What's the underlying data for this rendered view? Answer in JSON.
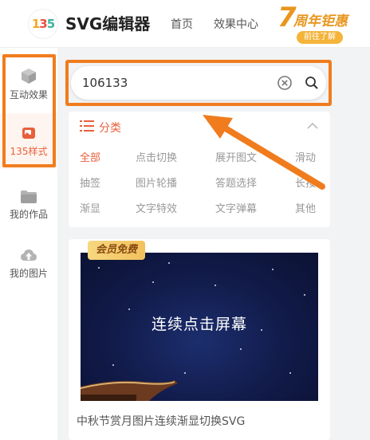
{
  "header": {
    "logo_text": "135",
    "title": "SVG编辑器",
    "nav": [
      "首页",
      "效果中心"
    ],
    "promo": {
      "number": "7",
      "title": "周年钜惠",
      "button": "前往了解"
    }
  },
  "sidebar": {
    "items": [
      {
        "label": "互动效果",
        "icon": "cube-icon"
      },
      {
        "label": "135样式",
        "icon": "image-gallery-icon"
      },
      {
        "label": "我的作品",
        "icon": "folder-icon"
      },
      {
        "label": "我的图片",
        "icon": "cloud-upload-icon"
      }
    ],
    "active_index": 1
  },
  "search": {
    "value": "106133"
  },
  "categories": {
    "title": "分类",
    "items": [
      "全部",
      "点击切换",
      "展开图文",
      "滑动",
      "抽签",
      "图片轮播",
      "答题选择",
      "长按",
      "渐显",
      "文字特效",
      "文字弹幕",
      "其他"
    ],
    "active": "全部"
  },
  "card": {
    "badge": "会员免费",
    "image_text": "连续点击屏幕",
    "title": "中秋节赏月图片连续渐显切换SVG"
  },
  "colors": {
    "accent": "#e8603c",
    "highlight": "#f07c1e"
  }
}
